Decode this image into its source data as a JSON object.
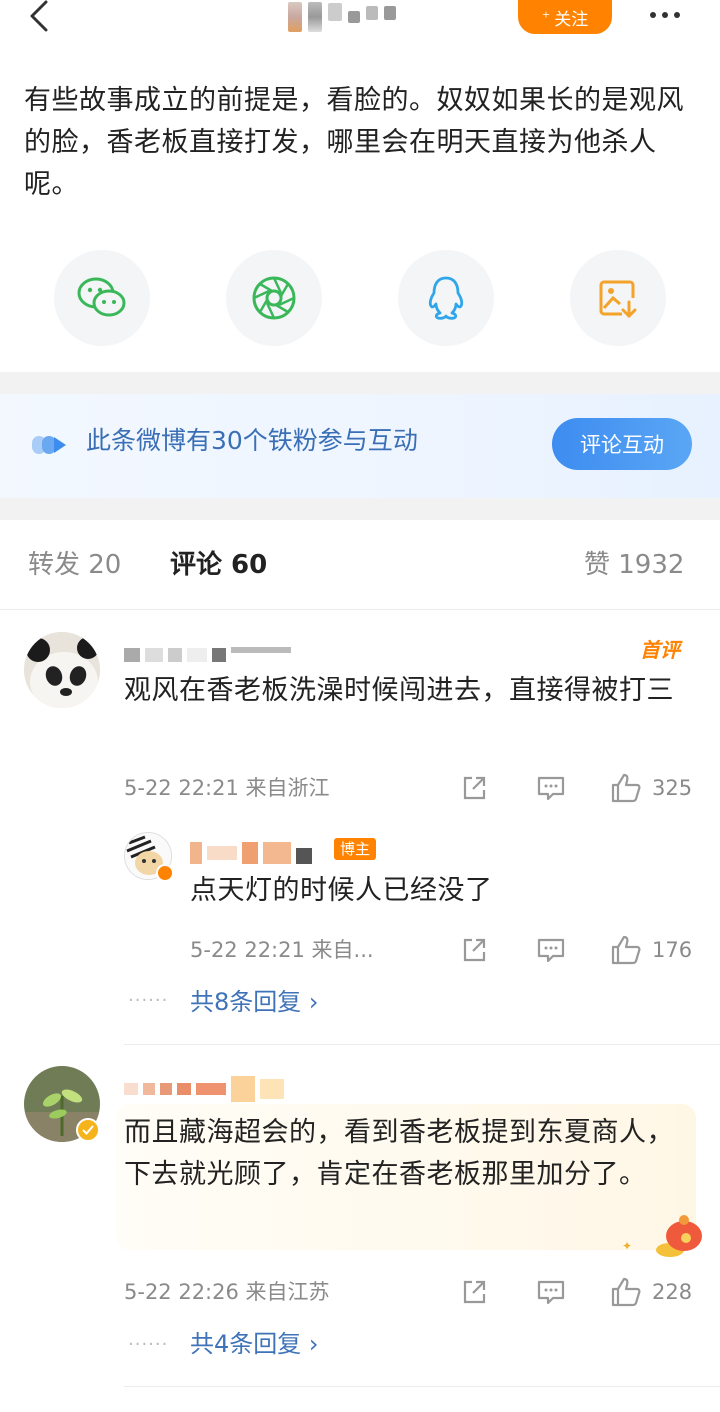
{
  "header": {
    "follow_label": "关注"
  },
  "post": {
    "text": "有些故事成立的前提是，看脸的。奴奴如果长的是观风的脸，香老板直接打发，哪里会在明天直接为他杀人呢。"
  },
  "share": {
    "items": [
      {
        "icon": "wechat-icon"
      },
      {
        "icon": "moments-icon"
      },
      {
        "icon": "qq-icon"
      },
      {
        "icon": "save-image-icon"
      }
    ]
  },
  "fans_banner": {
    "text": "此条微博有30个铁粉参与互动",
    "button_label": "评论互动"
  },
  "tabs": {
    "repost": "转发 20",
    "comment": "评论 60",
    "like": "赞 1932"
  },
  "comments": [
    {
      "badge": "首评",
      "text": "观风在香老板洗澡时候闯进去，直接得被打三",
      "meta": "5-22 22:21 来自浙江",
      "likes": "325",
      "reply": {
        "host_badge": "博主",
        "text": "点天灯的时候人已经没了",
        "meta": "5-22 22:21 来自...",
        "likes": "176"
      },
      "more_replies": "共8条回复 ›"
    },
    {
      "text": "而且藏海超会的，看到香老板提到东夏商人，下去就光顾了，肯定在香老板那里加分了。",
      "meta": "5-22 22:26 来自江苏",
      "likes": "228",
      "more_replies": "共4条回复 ›"
    }
  ],
  "colors": {
    "accent": "#ff8200",
    "link": "#3f73b7",
    "banner_text": "#3a6fb6"
  }
}
